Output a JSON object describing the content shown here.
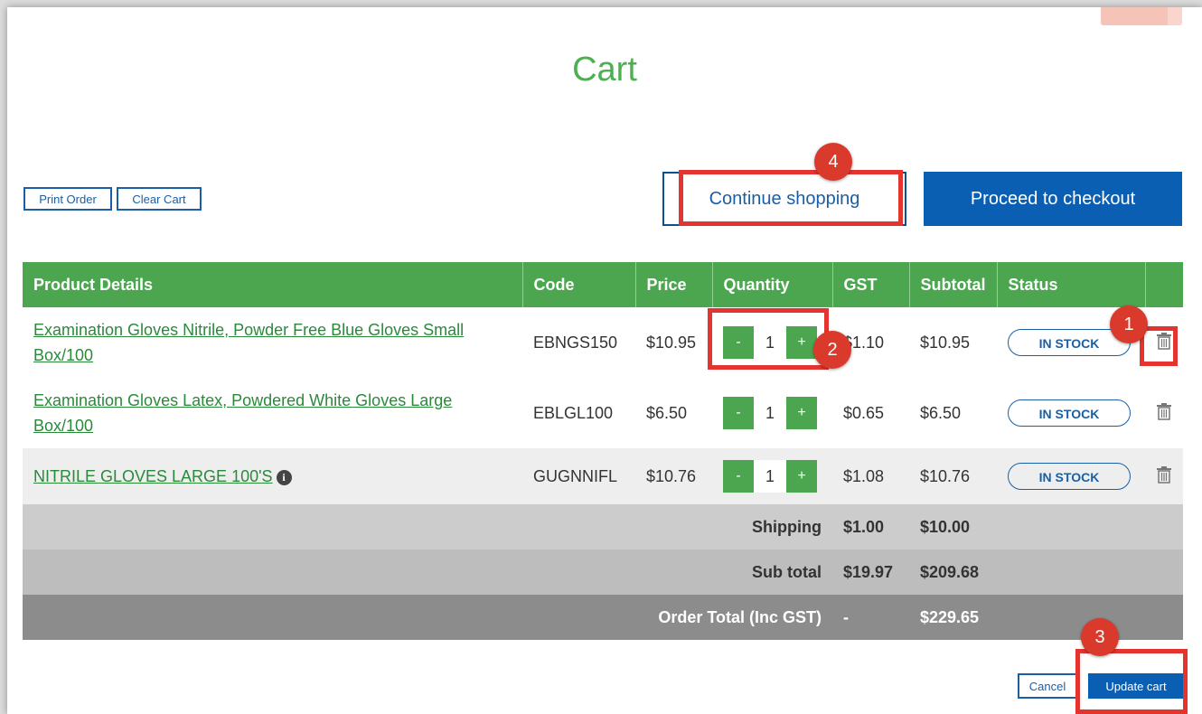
{
  "title": "Cart",
  "toolbar": {
    "print_label": "Print Order",
    "clear_label": "Clear Cart",
    "continue_label": "Continue shopping",
    "checkout_label": "Proceed to checkout"
  },
  "table": {
    "headers": [
      "Product Details",
      "Code",
      "Price",
      "Quantity",
      "GST",
      "Subtotal",
      "Status"
    ],
    "rows": [
      {
        "product": "Examination Gloves Nitrile, Powder Free Blue Gloves Small Box/100",
        "code": "EBNGS150",
        "price": "$10.95",
        "qty": "1",
        "gst": "$1.10",
        "subtotal": "$10.95",
        "status": "IN STOCK",
        "info": false
      },
      {
        "product": "Examination Gloves Latex, Powdered White Gloves Large Box/100",
        "code": "EBLGL100",
        "price": "$6.50",
        "qty": "1",
        "gst": "$0.65",
        "subtotal": "$6.50",
        "status": "IN STOCK",
        "info": false
      },
      {
        "product": "NITRILE GLOVES LARGE 100'S",
        "code": "GUGNNIFL",
        "price": "$10.76",
        "qty": "1",
        "gst": "$1.08",
        "subtotal": "$10.76",
        "status": "IN STOCK",
        "info": true
      }
    ],
    "qty_minus": "-",
    "qty_plus": "+",
    "info_glyph": "i",
    "summary": [
      {
        "label": "Shipping",
        "gst": "$1.00",
        "subtotal": "$10.00"
      },
      {
        "label": "Sub total",
        "gst": "$19.97",
        "subtotal": "$209.68"
      },
      {
        "label": "Order Total (Inc GST)",
        "gst": "-",
        "subtotal": "$229.65"
      }
    ]
  },
  "footer": {
    "cancel_label": "Cancel",
    "update_label": "Update cart"
  },
  "callouts": [
    "1",
    "2",
    "3",
    "4"
  ],
  "colors": {
    "brand_green": "#4ca64f",
    "brand_blue": "#0b5fb3",
    "callout_red": "#e3342f"
  }
}
